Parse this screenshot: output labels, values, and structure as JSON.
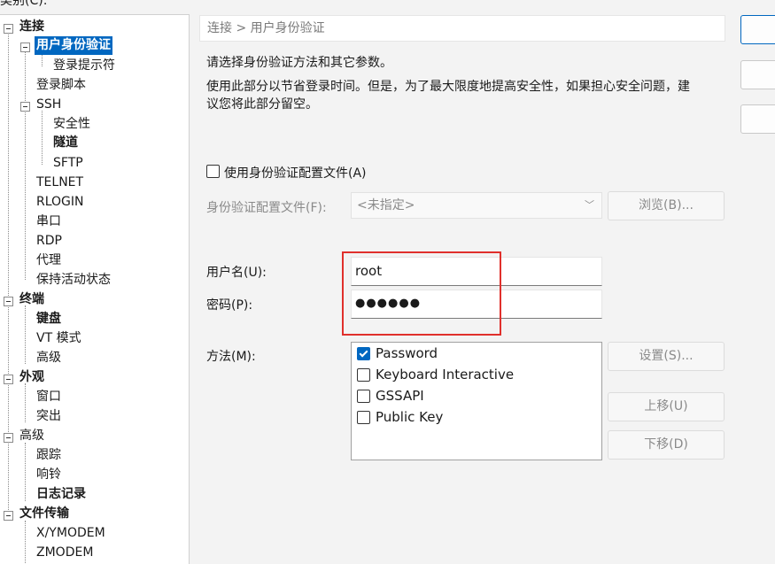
{
  "top_label": "类别(C):",
  "tree": {
    "items": [
      {
        "label": "连接",
        "bold": true
      },
      {
        "label": "用户身份验证",
        "bold": true,
        "selected": true
      },
      {
        "label": "登录提示符"
      },
      {
        "label": "登录脚本"
      },
      {
        "label": "SSH"
      },
      {
        "label": "安全性"
      },
      {
        "label": "隧道",
        "bold": true
      },
      {
        "label": "SFTP"
      },
      {
        "label": "TELNET"
      },
      {
        "label": "RLOGIN"
      },
      {
        "label": "串口"
      },
      {
        "label": "RDP"
      },
      {
        "label": "代理"
      },
      {
        "label": "保持活动状态"
      },
      {
        "label": "终端",
        "bold": true
      },
      {
        "label": "键盘",
        "bold": true
      },
      {
        "label": "VT 模式"
      },
      {
        "label": "高级"
      },
      {
        "label": "外观",
        "bold": true
      },
      {
        "label": "窗口"
      },
      {
        "label": "突出"
      },
      {
        "label": "高级"
      },
      {
        "label": "跟踪"
      },
      {
        "label": "响铃"
      },
      {
        "label": "日志记录",
        "bold": true
      },
      {
        "label": "文件传输",
        "bold": true
      },
      {
        "label": "X/YMODEM"
      },
      {
        "label": "ZMODEM"
      }
    ]
  },
  "breadcrumb": "连接 > 用户身份验证",
  "desc1": "请选择身份验证方法和其它参数。",
  "desc2_line1": "使用此部分以节省登录时间。但是，为了最大限度地提高安全性，如果担心安全问题，建",
  "desc2_line2": "议您将此部分留空。",
  "use_profile": {
    "label": "使用身份验证配置文件(A)",
    "checked": false
  },
  "profile": {
    "label": "身份验证配置文件(F):",
    "value": "<未指定>",
    "browse": "浏览(B)..."
  },
  "username": {
    "label": "用户名(U):",
    "value": "root"
  },
  "password": {
    "label": "密码(P):",
    "value": "●●●●●●"
  },
  "method": {
    "label": "方法(M):",
    "options": [
      {
        "label": "Password",
        "checked": true
      },
      {
        "label": "Keyboard Interactive",
        "checked": false
      },
      {
        "label": "GSSAPI",
        "checked": false
      },
      {
        "label": "Public Key",
        "checked": false
      }
    ],
    "settings": "设置(S)...",
    "move_up": "上移(U)",
    "move_down": "下移(D)"
  },
  "side_buttons": [
    "",
    "",
    ""
  ],
  "colors": {
    "accent": "#0067c0",
    "highlight_box": "#e0302c"
  }
}
